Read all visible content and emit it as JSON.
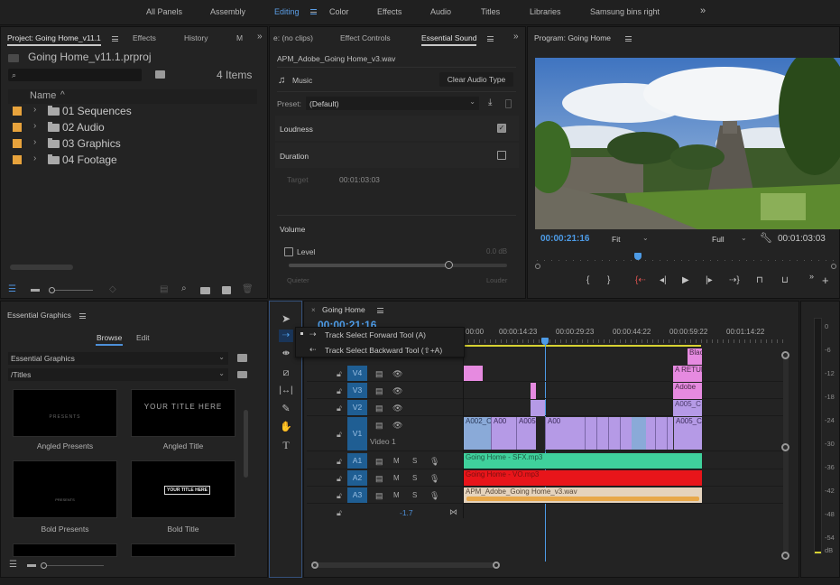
{
  "workspaces": {
    "items": [
      "All Panels",
      "Assembly",
      "Editing",
      "Color",
      "Effects",
      "Audio",
      "Titles",
      "Libraries",
      "Samsung bins right"
    ],
    "active": "Editing",
    "overflow": "»"
  },
  "project_panel": {
    "tabs": [
      "Project: Going Home_v11.1",
      "Effects",
      "History",
      "M"
    ],
    "active_tab": "Project: Going Home_v11.1",
    "project_file": "Going Home_v11.1.prproj",
    "search_placeholder": "",
    "item_count": "4 Items",
    "column_header": "Name",
    "bins": [
      {
        "name": "01 Sequences",
        "color": "#e8a33c"
      },
      {
        "name": "02 Audio",
        "color": "#e8a33c"
      },
      {
        "name": "03 Graphics",
        "color": "#e8a33c"
      },
      {
        "name": "04 Footage",
        "color": "#e8a33c"
      }
    ]
  },
  "essential_graphics": {
    "title": "Essential Graphics",
    "tabs": [
      "Browse",
      "Edit"
    ],
    "active_tab": "Browse",
    "source_select": "Essential Graphics",
    "folder_select": "/Titles",
    "templates": [
      {
        "name": "Angled Presents",
        "preview_text": "PRESENTS"
      },
      {
        "name": "Angled Title",
        "preview_text": "YOUR TITLE HERE"
      },
      {
        "name": "Bold Presents",
        "preview_text": "PRESENTS"
      },
      {
        "name": "Bold Title",
        "preview_text": "YOUR TITLE HERE"
      }
    ]
  },
  "essential_sound": {
    "tabs": [
      "e: (no clips)",
      "Effect Controls",
      "Essential Sound"
    ],
    "active_tab": "Essential Sound",
    "clip_name": "APM_Adobe_Going Home_v3.wav",
    "audio_type": "Music",
    "clear_button": "Clear Audio Type",
    "preset_label": "Preset:",
    "preset_value": "(Default)",
    "loudness": {
      "label": "Loudness",
      "checked": true
    },
    "duration": {
      "label": "Duration",
      "checked": false,
      "target_label": "Target",
      "target_value": "00:01:03:03"
    },
    "volume": {
      "label": "Volume",
      "level_label": "Level",
      "level_checked": false,
      "level_value": "0.0 dB",
      "slider_fraction": 0.73,
      "min_label": "Quieter",
      "max_label": "Louder"
    }
  },
  "program_monitor": {
    "title": "Program: Going Home",
    "current_timecode": "00:00:21:16",
    "zoom": "Fit",
    "resolution": "Full",
    "duration": "00:01:03:03",
    "playhead_fraction": 0.34
  },
  "timeline": {
    "sequence_name": "Going Home",
    "timecode": "00:00:21:16",
    "ruler": [
      "00:00",
      "00:00:14:23",
      "00:00:29:23",
      "00:00:44:22",
      "00:00:59:22",
      "00:01:14:22"
    ],
    "tooltip": {
      "items": [
        "Track Select Forward Tool (A)",
        "Track Select Backward Tool (⇧+A)"
      ]
    },
    "video_tracks": [
      {
        "id": "V4"
      },
      {
        "id": "V3"
      },
      {
        "id": "V2"
      },
      {
        "id": "V1",
        "name": "Video 1"
      }
    ],
    "audio_tracks": [
      {
        "id": "A1",
        "m": "M",
        "s": "S"
      },
      {
        "id": "A2",
        "m": "M",
        "s": "S"
      },
      {
        "id": "A3",
        "m": "M",
        "s": "S"
      }
    ],
    "master_value": "-1.7",
    "clips": {
      "v5": "Blac",
      "v4_end": "A RETUR",
      "v3_end": "Adobe",
      "v2_end": "A005_C",
      "v1": [
        "A002_C",
        "A00",
        "A005",
        "A00",
        "A005_C"
      ],
      "a1": "Going Home - SFX.mp3",
      "a2": "Going Home - VO.mp3",
      "a3": "APM_Adobe_Going Home_v3.wav"
    },
    "clip_colors": {
      "video": "#b59ae6",
      "graphic": "#e68ae0",
      "v1_blue": "#8aaad8",
      "a1": "#3fd19c",
      "a2": "#e8151a",
      "a3": "#e8b877"
    }
  },
  "audio_meter": {
    "scale": [
      "0",
      "-6",
      "-12",
      "-18",
      "-24",
      "-30",
      "-36",
      "-42",
      "-48",
      "-54",
      "dB"
    ]
  }
}
